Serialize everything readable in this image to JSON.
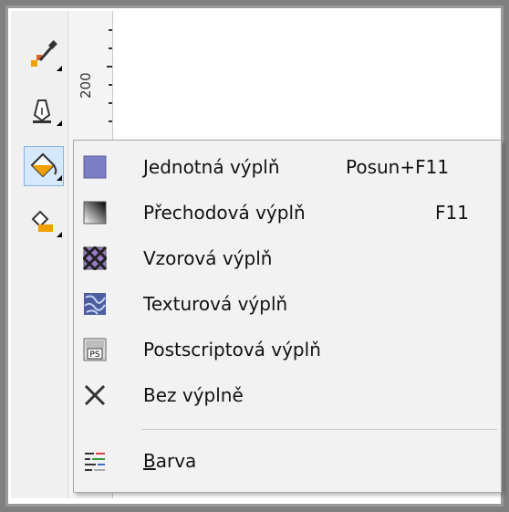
{
  "ruler": {
    "label": "200"
  },
  "menu": {
    "items": [
      {
        "label": "Jednotná výplň",
        "shortcut": "Posun+F11",
        "icon": "uniform-fill-icon"
      },
      {
        "label": "Přechodová výplň",
        "shortcut": "F11",
        "icon": "fountain-fill-icon"
      },
      {
        "label": "Vzorová výplň",
        "shortcut": "",
        "icon": "pattern-fill-icon"
      },
      {
        "label": "Texturová výplň",
        "shortcut": "",
        "icon": "texture-fill-icon"
      },
      {
        "label": "Postscriptová výplň",
        "shortcut": "",
        "icon": "postscript-fill-icon"
      },
      {
        "label": "Bez výplně",
        "shortcut": "",
        "icon": "no-fill-icon"
      }
    ],
    "color_item": {
      "label_first": "B",
      "label_rest": "arva",
      "icon": "color-docker-icon"
    }
  },
  "colors": {
    "uniform": "#7a80c3",
    "accent": "#f0a000"
  }
}
